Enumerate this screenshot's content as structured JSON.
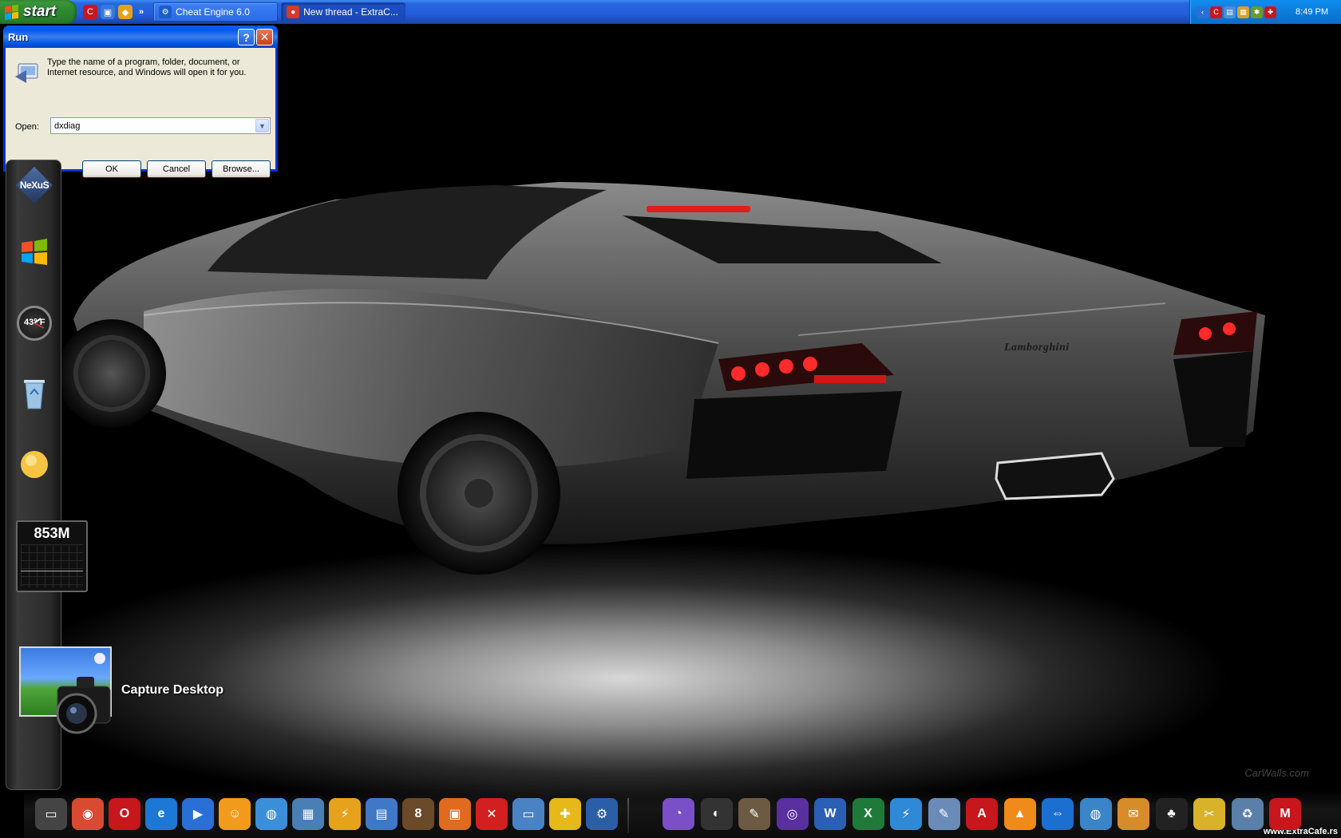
{
  "taskbar": {
    "start_label": "start",
    "quick_launch": [
      "ccleaner-icon",
      "show-desktop-icon",
      "winamp-icon"
    ],
    "chevron": "»",
    "tasks": [
      {
        "label": "Cheat Engine 6.0",
        "icon": "cheat-engine-icon",
        "color": "#1a5ec7"
      },
      {
        "label": "New thread - ExtraC...",
        "icon": "chrome-icon",
        "color": "#d13b2a"
      }
    ],
    "tray": {
      "icons": [
        "back-arrow-icon",
        "ccleaner-icon",
        "network-icon",
        "folder-icon",
        "bug-icon",
        "shield-icon"
      ],
      "clock": "8:49 PM"
    }
  },
  "run_dialog": {
    "title": "Run",
    "help_glyph": "?",
    "close_glyph": "✕",
    "description": "Type the name of a program, folder, document, or Internet resource, and Windows will open it for you.",
    "open_label": "Open:",
    "open_value": "dxdiag",
    "ok": "OK",
    "cancel": "Cancel",
    "browse": "Browse..."
  },
  "sidebar": {
    "logo": "NeXuS",
    "weather_temp": "43° F",
    "memory": "853M"
  },
  "capture": {
    "label": "Capture Desktop"
  },
  "wallpaper": {
    "brand": "Lamborghini",
    "watermark": "CarWalls.com"
  },
  "dock": {
    "watermark": "www.ExtraCafe.rs",
    "left_icons": [
      {
        "name": "run-shortcut-icon",
        "color": "#444"
      },
      {
        "name": "chrome-icon",
        "color": "#d94a32"
      },
      {
        "name": "opera-icon",
        "color": "#c8161d"
      },
      {
        "name": "internet-explorer-icon",
        "color": "#1c78d4"
      },
      {
        "name": "media-player-icon",
        "color": "#2a6fd6"
      },
      {
        "name": "messenger-icon",
        "color": "#f29a1b"
      },
      {
        "name": "network-globe-icon",
        "color": "#3a8fd8"
      },
      {
        "name": "control-panel-icon",
        "color": "#4a7fb5"
      },
      {
        "name": "winamp-icon",
        "color": "#e6a21a"
      },
      {
        "name": "folder-icon",
        "color": "#3f78c7"
      },
      {
        "name": "billiard-icon",
        "color": "#6b4a2a"
      },
      {
        "name": "office-icon",
        "color": "#e06a1e"
      },
      {
        "name": "close-x-icon",
        "color": "#d21f1f"
      },
      {
        "name": "computer-icon",
        "color": "#4a82c6"
      },
      {
        "name": "playstation-icon",
        "color": "#e6b81a"
      },
      {
        "name": "settings-gear-icon",
        "color": "#2a5fa8"
      }
    ],
    "right_icons": [
      {
        "name": "picasa-icon",
        "color": "#7a4fc8"
      },
      {
        "name": "photoscape-icon",
        "color": "#333"
      },
      {
        "name": "gimp-icon",
        "color": "#6d5a42"
      },
      {
        "name": "torrent-icon",
        "color": "#5a2fa0"
      },
      {
        "name": "word-icon",
        "color": "#2b5fb5"
      },
      {
        "name": "excel-icon",
        "color": "#1f7a3a"
      },
      {
        "name": "lightning-icon",
        "color": "#2e8ad6"
      },
      {
        "name": "edit-icon",
        "color": "#6a8bb8"
      },
      {
        "name": "acrobat-icon",
        "color": "#c8161d"
      },
      {
        "name": "vlc-icon",
        "color": "#f08a1b"
      },
      {
        "name": "teamviewer-icon",
        "color": "#1b6fd1"
      },
      {
        "name": "world-icon",
        "color": "#3a84c8"
      },
      {
        "name": "thunderbird-icon",
        "color": "#d78c2a"
      },
      {
        "name": "shirt-icon",
        "color": "#222"
      },
      {
        "name": "tools-icon",
        "color": "#d8b22a"
      },
      {
        "name": "recycle-bin-icon",
        "color": "#5a7fa8"
      },
      {
        "name": "m-logo-icon",
        "color": "#c8161d"
      }
    ]
  },
  "colors": {
    "taskbar": "#245edb",
    "start": "#2f8a2f",
    "dialog": "#ece9d8",
    "title_bar": "#0054e3"
  }
}
